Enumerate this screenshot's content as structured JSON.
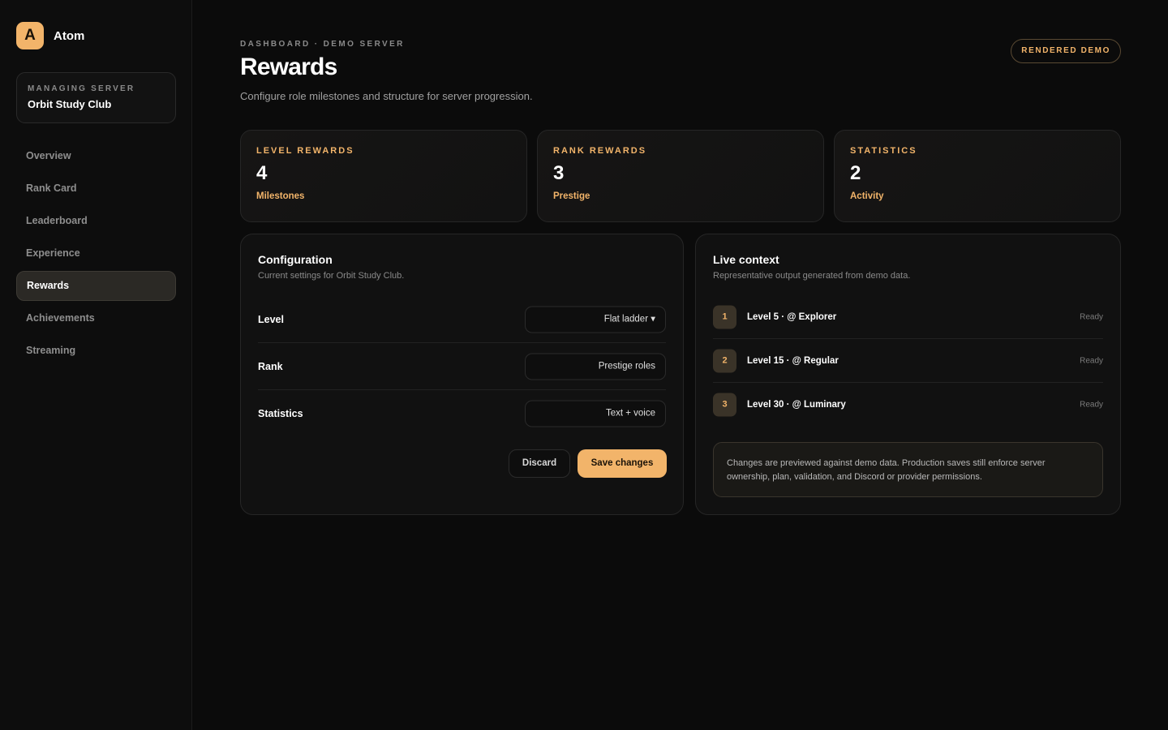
{
  "brand": {
    "logo_letter": "A",
    "name": "Atom"
  },
  "server": {
    "eyebrow": "MANAGING SERVER",
    "name": "Orbit Study Club"
  },
  "nav": [
    {
      "label": "Overview",
      "active": false
    },
    {
      "label": "Rank Card",
      "active": false
    },
    {
      "label": "Leaderboard",
      "active": false
    },
    {
      "label": "Experience",
      "active": false
    },
    {
      "label": "Rewards",
      "active": true
    },
    {
      "label": "Achievements",
      "active": false
    },
    {
      "label": "Streaming",
      "active": false
    }
  ],
  "header": {
    "breadcrumb": "DASHBOARD · DEMO SERVER",
    "title": "Rewards",
    "subtitle": "Configure role milestones and structure for server progression.",
    "badge": "RENDERED DEMO"
  },
  "stats": [
    {
      "label": "LEVEL REWARDS",
      "value": "4",
      "sub": "Milestones"
    },
    {
      "label": "RANK REWARDS",
      "value": "3",
      "sub": "Prestige"
    },
    {
      "label": "STATISTICS",
      "value": "2",
      "sub": "Activity"
    }
  ],
  "config": {
    "title": "Configuration",
    "subtitle": "Current settings for Orbit Study Club.",
    "rows": [
      {
        "label": "Level",
        "value": "Flat ladder ▾"
      },
      {
        "label": "Rank",
        "value": "Prestige roles"
      },
      {
        "label": "Statistics",
        "value": "Text + voice"
      }
    ],
    "discard_label": "Discard",
    "save_label": "Save changes"
  },
  "live": {
    "title": "Live context",
    "subtitle": "Representative output generated from demo data.",
    "items": [
      {
        "num": "1",
        "text": "Level 5 · @ Explorer",
        "status": "Ready"
      },
      {
        "num": "2",
        "text": "Level 15 · @ Regular",
        "status": "Ready"
      },
      {
        "num": "3",
        "text": "Level 30 · @ Luminary",
        "status": "Ready"
      }
    ],
    "note": "Changes are previewed against demo data. Production saves still enforce server ownership, plan, validation, and Discord or provider permissions."
  },
  "colors": {
    "accent": "#f2b46a",
    "background": "#0b0b0b",
    "panel": "#111111"
  }
}
